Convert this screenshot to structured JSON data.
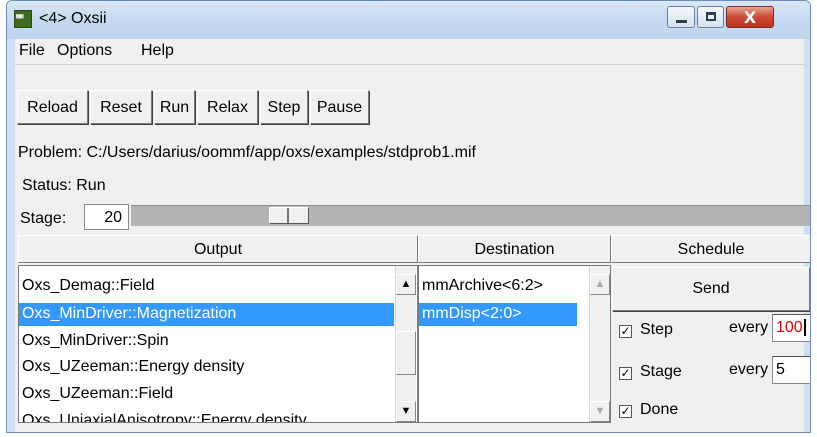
{
  "window": {
    "title": "<4> Oxsii",
    "app_icon_text": "▦▦",
    "close_glyph": "X"
  },
  "menu": {
    "file": "File",
    "options": "Options",
    "help": "Help"
  },
  "toolbar": {
    "reload": "Reload",
    "reset": "Reset",
    "run": "Run",
    "relax": "Relax",
    "step": "Step",
    "pause": "Pause"
  },
  "problem": "Problem: C:/Users/darius/oommf/app/oxs/examples/stdprob1.mif",
  "status": "Status: Run",
  "stage": {
    "label": "Stage:",
    "value": "20",
    "slider_fraction": 0.215
  },
  "output": {
    "header": "Output",
    "items": [
      "Oxs_Demag::Field",
      "Oxs_MinDriver::Magnetization",
      "Oxs_MinDriver::Spin",
      "Oxs_UZeeman::Energy density",
      "Oxs_UZeeman::Field",
      "Oxs_UniaxialAnisotropy::Energy density"
    ],
    "selected_index": 1
  },
  "destination": {
    "header": "Destination",
    "items": [
      "mmArchive<6:2>",
      "mmDisp<2:0>"
    ],
    "selected_index": 1
  },
  "schedule": {
    "header": "Schedule",
    "send": "Send",
    "step": {
      "label": "Step",
      "checked": true,
      "every_label": "every",
      "every_value": "100"
    },
    "stage": {
      "label": "Stage",
      "checked": true,
      "every_label": "every",
      "every_value": "5"
    },
    "done": {
      "label": "Done",
      "checked": true
    }
  },
  "colors": {
    "selection": "#3399ff",
    "active_entry_text": "#e00000",
    "title_bar": "#c4d9f1"
  }
}
